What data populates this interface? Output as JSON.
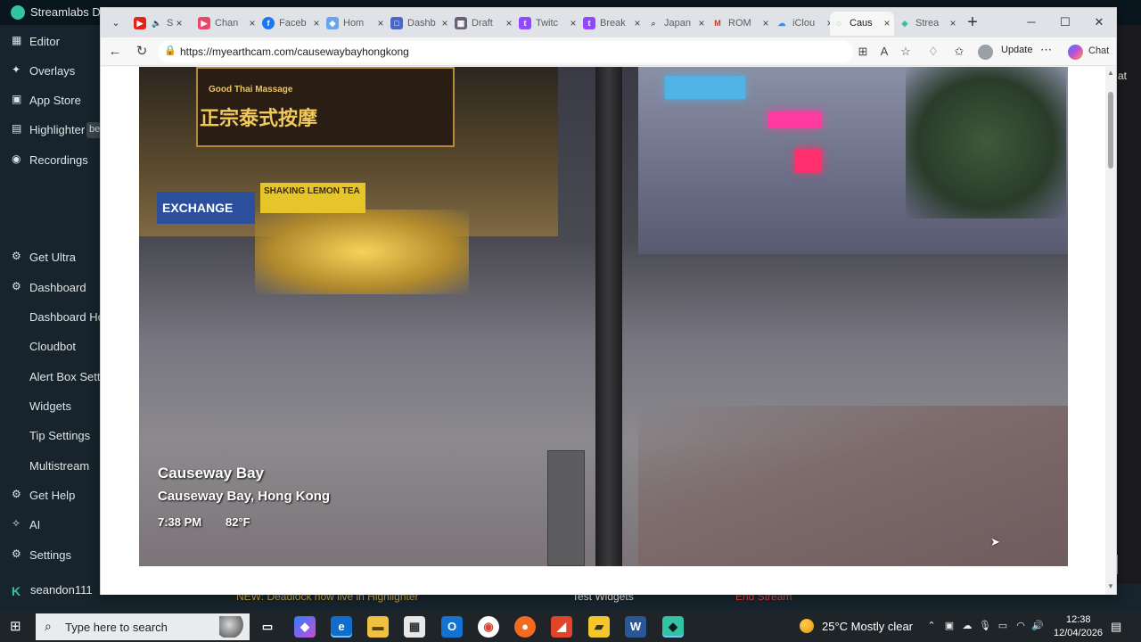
{
  "streamlabs": {
    "title": "Streamlabs De",
    "beta_badge": "be",
    "right_edge_text": "at",
    "sidebar": [
      {
        "label": "Editor",
        "icon": "editor-icon"
      },
      {
        "label": "Overlays",
        "icon": "overlays-icon"
      },
      {
        "label": "App Store",
        "icon": "app-store-icon"
      },
      {
        "label": "Highlighter",
        "icon": "highlighter-icon"
      },
      {
        "label": "Recordings",
        "icon": "recordings-icon"
      },
      {
        "label": "Get Ultra",
        "icon": "ultra-icon"
      },
      {
        "label": "Dashboard",
        "icon": "dashboard-icon"
      },
      {
        "label": "Dashboard Hor",
        "icon": ""
      },
      {
        "label": "Cloudbot",
        "icon": ""
      },
      {
        "label": "Alert Box Settin",
        "icon": ""
      },
      {
        "label": "Widgets",
        "icon": ""
      },
      {
        "label": "Tip Settings",
        "icon": ""
      },
      {
        "label": "Multistream",
        "icon": ""
      },
      {
        "label": "Get Help",
        "icon": "help-icon"
      },
      {
        "label": "AI",
        "icon": "ai-icon"
      },
      {
        "label": "Settings",
        "icon": "settings-icon"
      }
    ],
    "username": "seandon111",
    "bottom_strip": {
      "text1": "NEW: Deadlock now live in Highlighter",
      "text2": "Test Widgets",
      "text3": "End Stream"
    }
  },
  "browser": {
    "tabs": [
      {
        "label": "S",
        "favicon": "youtube-icon",
        "color": "#e62117"
      },
      {
        "label": "Chan",
        "favicon": "youtube-studio-icon",
        "color": "#e8466b"
      },
      {
        "label": "Faceb",
        "favicon": "facebook-icon",
        "color": "#1877f2"
      },
      {
        "label": "Hom",
        "favicon": "home-icon",
        "color": "#6aa5e8"
      },
      {
        "label": "Dashb",
        "favicon": "dashboard-icon",
        "color": "#4a67c8"
      },
      {
        "label": "Draft",
        "favicon": "draft-icon",
        "color": "#6b5f7a"
      },
      {
        "label": "Twitc",
        "favicon": "twitch-icon",
        "color": "#9146ff"
      },
      {
        "label": "Break",
        "favicon": "twitch-icon",
        "color": "#9146ff"
      },
      {
        "label": "Japan",
        "favicon": "search-icon",
        "color": "#5f6368"
      },
      {
        "label": "ROM",
        "favicon": "gmail-icon",
        "color": "#d93025"
      },
      {
        "label": "iClou",
        "favicon": "icloud-icon",
        "color": "#3a8ee6"
      },
      {
        "label": "Caus",
        "favicon": "edge-icon",
        "color": "#0f9d58",
        "active": true
      },
      {
        "label": "Strea",
        "favicon": "streamlabs-icon",
        "color": "#31c3a2"
      }
    ],
    "url": "https://myearthcam.com/causewaybayhongkong",
    "update_label": "Update",
    "chat_label": "Chat"
  },
  "webcam": {
    "name": "Causeway Bay",
    "location": "Causeway Bay, Hong Kong",
    "time": "7:38 PM",
    "temperature": "82°F",
    "signs": {
      "thai_massage": "Good Thai Massage",
      "thai_chinese": "正宗泰式按摩",
      "exchange": "EXCHANGE",
      "lemon_tea": "SHAKING LEMON TEA"
    }
  },
  "taskbar": {
    "search_placeholder": "Type here to search",
    "weather": "25°C  Mostly clear",
    "time": "12:38",
    "date": "12/04/2026"
  }
}
